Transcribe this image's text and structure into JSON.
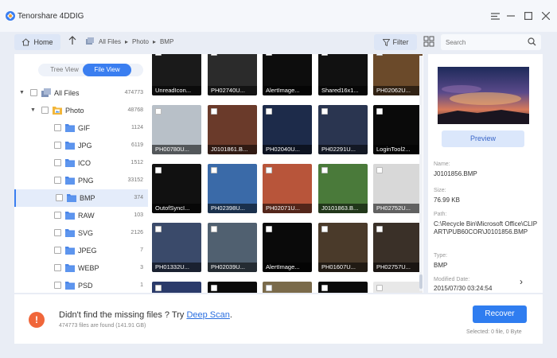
{
  "app": {
    "title": "Tenorshare 4DDIG",
    "brand_color": "#3a7ef0"
  },
  "toolbar": {
    "home_label": "Home",
    "breadcrumb": [
      "All Files",
      "Photo",
      "BMP"
    ],
    "filter_label": "Filter",
    "search_placeholder": "Search"
  },
  "tabs": {
    "tree": "Tree View",
    "file": "File View"
  },
  "tree": [
    {
      "label": "All Files",
      "count": "474773",
      "level": 0,
      "caret": "▼",
      "icon": "all-files-icon"
    },
    {
      "label": "Photo",
      "count": "48768",
      "level": 1,
      "caret": "▼",
      "icon": "photo-folder-icon"
    },
    {
      "label": "GIF",
      "count": "1124",
      "level": 2,
      "icon": "folder-icon"
    },
    {
      "label": "JPG",
      "count": "6119",
      "level": 2,
      "icon": "folder-icon"
    },
    {
      "label": "ICO",
      "count": "1512",
      "level": 2,
      "icon": "folder-icon"
    },
    {
      "label": "PNG",
      "count": "33152",
      "level": 2,
      "icon": "folder-icon"
    },
    {
      "label": "BMP",
      "count": "374",
      "level": 2,
      "icon": "folder-icon",
      "selected": true
    },
    {
      "label": "RAW",
      "count": "103",
      "level": 2,
      "icon": "folder-icon"
    },
    {
      "label": "SVG",
      "count": "2126",
      "level": 2,
      "icon": "folder-icon"
    },
    {
      "label": "JPEG",
      "count": "7",
      "level": 2,
      "icon": "folder-icon"
    },
    {
      "label": "WEBP",
      "count": "3",
      "level": 2,
      "icon": "folder-icon"
    },
    {
      "label": "PSD",
      "count": "1",
      "level": 2,
      "icon": "folder-icon"
    }
  ],
  "thumbnails": [
    {
      "name": "UnreadIcon...",
      "bg": "#1a1a1a"
    },
    {
      "name": "PH02740U...",
      "bg": "#2b2b2b"
    },
    {
      "name": "AlertImage...",
      "bg": "#0d0d0d"
    },
    {
      "name": "Shared16x1...",
      "bg": "#111111"
    },
    {
      "name": "PH02062U...",
      "bg": "#6b4a2a"
    },
    {
      "name": "PH00780U...",
      "bg": "#b8c0c8"
    },
    {
      "name": "J0101861.B...",
      "bg": "#6a3a2a"
    },
    {
      "name": "PH02040U...",
      "bg": "#1d2b4a"
    },
    {
      "name": "PH02291U...",
      "bg": "#2a3550"
    },
    {
      "name": "LoginTool2...",
      "bg": "#0a0a0a"
    },
    {
      "name": "OutofSyncI...",
      "bg": "#111111"
    },
    {
      "name": "PH02398U...",
      "bg": "#3a6aa8"
    },
    {
      "name": "PH02071U...",
      "bg": "#b8553a"
    },
    {
      "name": "J0101863.B...",
      "bg": "#4a7a3a"
    },
    {
      "name": "PH02752U...",
      "bg": "#d8d8d8"
    },
    {
      "name": "PH01332U...",
      "bg": "#3a4a6a"
    },
    {
      "name": "PH02039U...",
      "bg": "#506070"
    },
    {
      "name": "AlertImage...",
      "bg": "#0a0a0a"
    },
    {
      "name": "PH01607U...",
      "bg": "#4a3a2a"
    },
    {
      "name": "PH02757U...",
      "bg": "#3a3028"
    },
    {
      "name": "",
      "bg": "#2a3a6a"
    },
    {
      "name": "",
      "bg": "#0a0a0a"
    },
    {
      "name": "",
      "bg": "#7a6a4a"
    },
    {
      "name": "",
      "bg": "#0a0a0a"
    },
    {
      "name": "",
      "bg": "#e8e8e8"
    }
  ],
  "details": {
    "preview_label": "Preview",
    "name_label": "Name:",
    "name": "J0101856.BMP",
    "size_label": "Size:",
    "size": "76.99 KB",
    "path_label": "Path:",
    "path": "C:\\Recycle Bin\\Microsoft Office\\CLIPART\\PUB60COR\\J0101856.BMP",
    "type_label": "Type:",
    "type": "BMP",
    "modified_label": "Modified Date:",
    "modified": "2015/07/30 03:24:54"
  },
  "bottom": {
    "msg_prefix": "Didn't find the missing files ? Try ",
    "deep_scan": "Deep Scan",
    "msg_suffix": ".",
    "found": "474773 files are found (141.91 GB)",
    "recover": "Recover",
    "selected": "Selected: 0 file, 0 Byte"
  }
}
